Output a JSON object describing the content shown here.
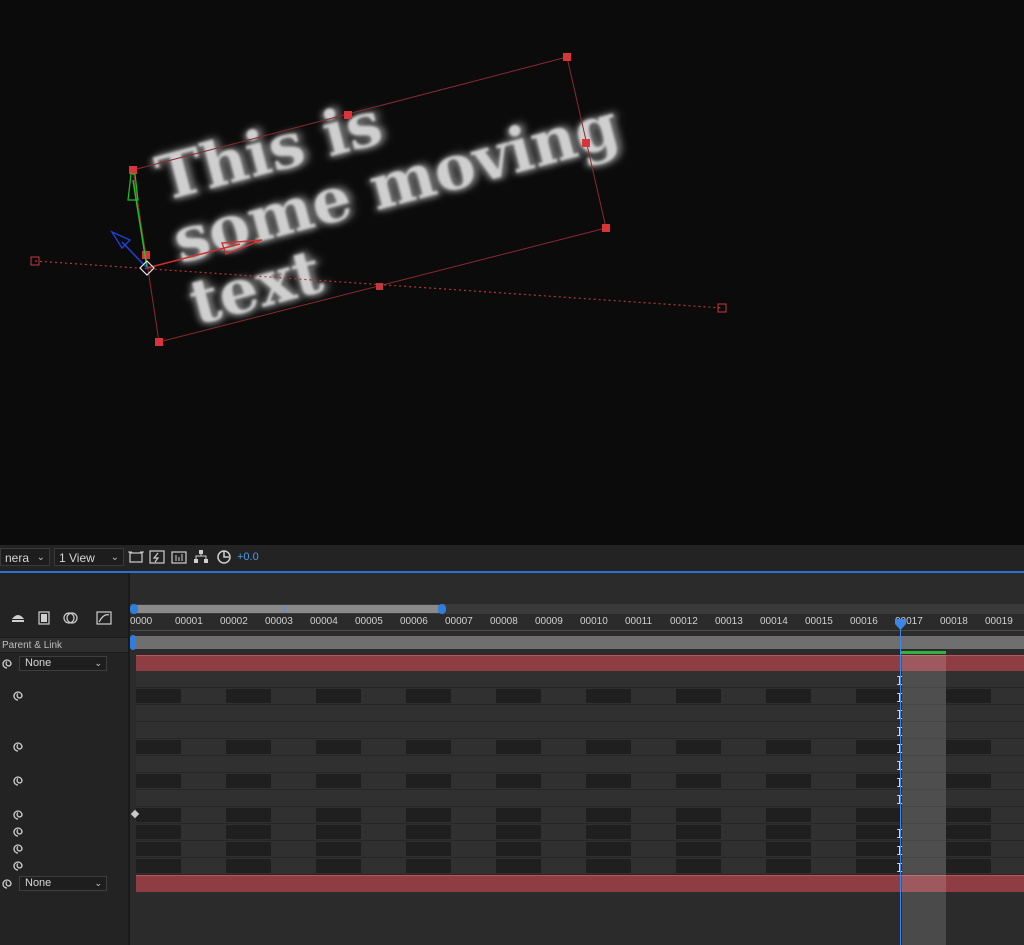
{
  "viewer": {
    "text_lines": [
      "This is",
      "some moving",
      "text"
    ]
  },
  "viewer_toolbar": {
    "camera_dropdown": "nera",
    "view_dropdown": "1 View",
    "exposure_value": "+0.0"
  },
  "timeline": {
    "column_header": "Parent & Link",
    "ticks": [
      "0000",
      "00001",
      "00002",
      "00003",
      "00004",
      "00005",
      "00006",
      "00007",
      "00008",
      "00009",
      "00010",
      "00011",
      "00012",
      "00013",
      "00014",
      "00015",
      "00016",
      "00017",
      "00018",
      "00019"
    ],
    "layers": [
      {
        "parent": "None"
      },
      {
        "parent": "None"
      }
    ]
  },
  "colors": {
    "accent": "#2f7de0",
    "layer_bar": "#8e3d42",
    "playhead": "#3b86e6",
    "keyframe_green": "#2fb33c"
  }
}
